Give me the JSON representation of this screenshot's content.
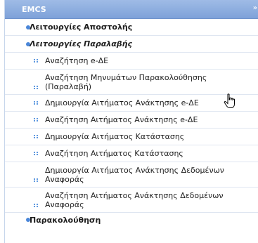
{
  "header": {
    "title": "EMCS",
    "collapse_icon": "double-chevron-up-icon"
  },
  "sections": [
    {
      "label": "Λειτουργίες Αποστολής"
    },
    {
      "label": "Λειτουργίες Παραλαβής"
    }
  ],
  "items": [
    {
      "label": "Αναζήτηση e-ΔΕ"
    },
    {
      "label": "Αναζήτηση Μηνυμάτων Παρακολούθησης (Παραλαβή)"
    },
    {
      "label": "Δημιουργία Αιτήματος Ανάκτησης e-ΔΕ"
    },
    {
      "label": "Αναζήτηση Αιτήματος Ανάκτησης e-ΔΕ"
    },
    {
      "label": "Δημιουργία Αιτήματος Κατάστασης"
    },
    {
      "label": "Αναζήτηση Αιτήματος Κατάστασης"
    },
    {
      "label": "Δημιουργία Αιτήματος Ανάκτησης Δεδομένων Αναφοράς"
    },
    {
      "label": "Αναζήτηση Αιτήματος Ανάκτησης Δεδομένων Αναφοράς"
    }
  ],
  "last_section": {
    "label": "Παρακολούθηση"
  },
  "colors": {
    "header": "#7ea2d9",
    "bullet": "#4a86d8",
    "dots": "#5f99e0"
  }
}
